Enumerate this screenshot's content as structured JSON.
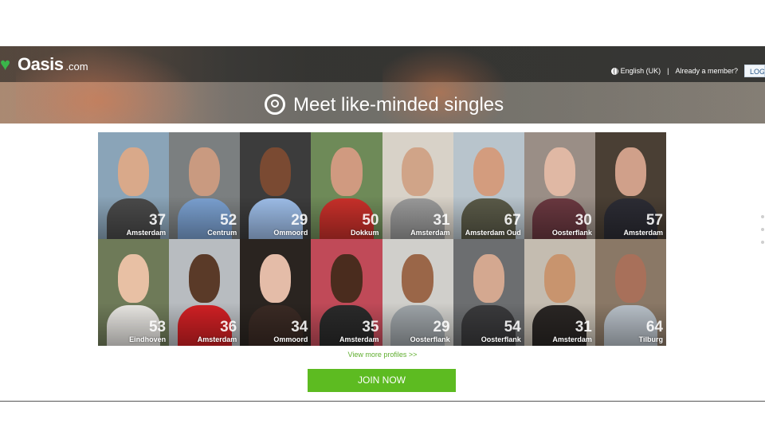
{
  "brand": {
    "name": "Oasis",
    "suffix": ".com",
    "heart_icon": "heart-icon",
    "accent": "#3ab54a"
  },
  "topnav": {
    "language": "English (UK)",
    "separator": "|",
    "member_text": "Already a member?",
    "login": "LOGIN"
  },
  "hero": {
    "tagline": "Meet like-minded singles"
  },
  "profiles": [
    {
      "age": "37",
      "city": "Amsterdam",
      "bg": "#8aa4b8",
      "skin": "#d9a98a",
      "shirt": "#4a4a4a"
    },
    {
      "age": "52",
      "city": "Centrum",
      "bg": "#7b7f80",
      "skin": "#c99a80",
      "shirt": "#7aa0d0"
    },
    {
      "age": "29",
      "city": "Ommoord",
      "bg": "#3c3c3c",
      "skin": "#7a4a32",
      "shirt": "#9dbde8"
    },
    {
      "age": "50",
      "city": "Dokkum",
      "bg": "#6e8a58",
      "skin": "#d09a80",
      "shirt": "#c8302a"
    },
    {
      "age": "31",
      "city": "Amsterdam",
      "bg": "#d8d2c8",
      "skin": "#d0a488",
      "shirt": "#9a9a9a"
    },
    {
      "age": "67",
      "city": "Amsterdam Oud",
      "bg": "#b8c4cc",
      "skin": "#d39c7e",
      "shirt": "#5a5a48"
    },
    {
      "age": "30",
      "city": "Oosterflank",
      "bg": "#9a8e86",
      "skin": "#e0b8a4",
      "shirt": "#6a3840"
    },
    {
      "age": "57",
      "city": "Amsterdam",
      "bg": "#4a3f34",
      "skin": "#d0a08a",
      "shirt": "#2c2c34"
    },
    {
      "age": "53",
      "city": "Eindhoven",
      "bg": "#6e7a58",
      "skin": "#e8c0a4",
      "shirt": "#e8e6e2"
    },
    {
      "age": "36",
      "city": "Amsterdam",
      "bg": "#b8bcc0",
      "skin": "#5a3a28",
      "shirt": "#d02024"
    },
    {
      "age": "34",
      "city": "Ommoord",
      "bg": "#2a2420",
      "skin": "#e4bca8",
      "shirt": "#3a2a24"
    },
    {
      "age": "35",
      "city": "Amsterdam",
      "bg": "#c04a58",
      "skin": "#4a2c1e",
      "shirt": "#2a2a2a"
    },
    {
      "age": "29",
      "city": "Oosterflank",
      "bg": "#d0cfcb",
      "skin": "#9a6648",
      "shirt": "#9ea4a8"
    },
    {
      "age": "54",
      "city": "Oosterflank",
      "bg": "#6c6e70",
      "skin": "#d4a890",
      "shirt": "#3a3a3c"
    },
    {
      "age": "31",
      "city": "Amsterdam",
      "bg": "#c4bcb0",
      "skin": "#c8946e",
      "shirt": "#2a2624"
    },
    {
      "age": "64",
      "city": "Tilburg",
      "bg": "#8a7866",
      "skin": "#a8705a",
      "shirt": "#b8c0c8"
    }
  ],
  "links": {
    "view_more": "View more profiles >>"
  },
  "cta": {
    "join": "JOIN NOW",
    "color": "#5dbb21"
  }
}
